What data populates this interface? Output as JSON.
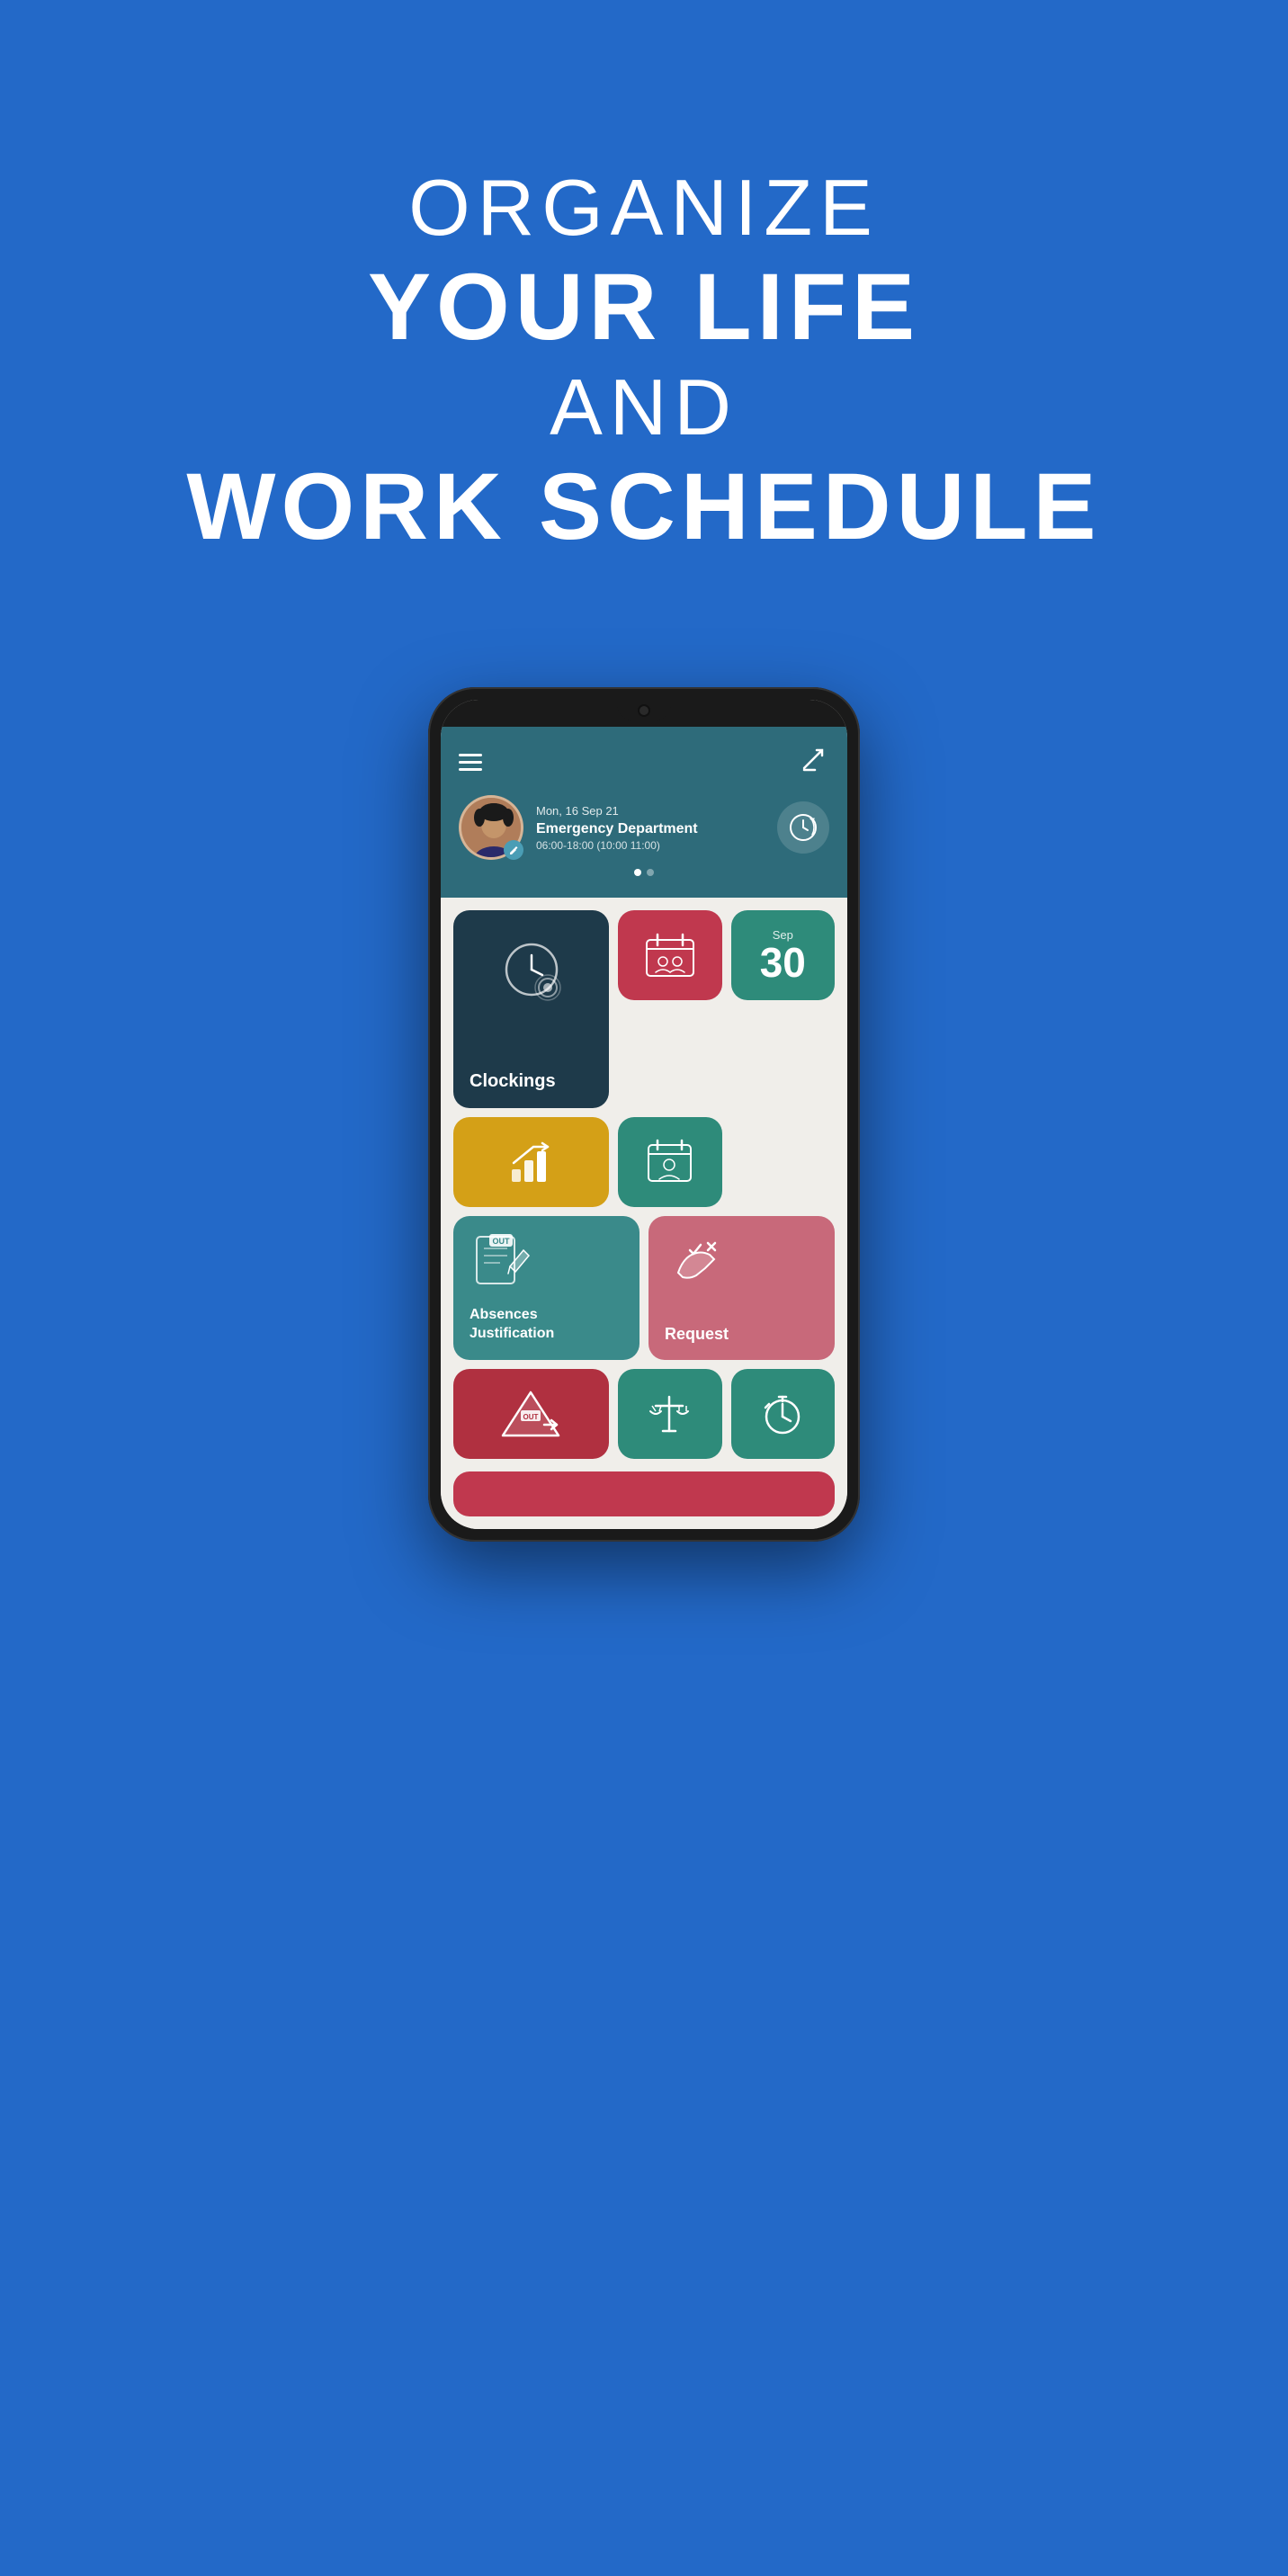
{
  "hero": {
    "line1": "ORGANIZE",
    "line2": "YOUR LIFE",
    "line3": "AND",
    "line4": "WORK SCHEDULE"
  },
  "phone": {
    "header": {
      "date": "Mon, 16 Sep 21",
      "department": "Emergency Department",
      "time": "06:00-18:00 (10:00 11:00)"
    },
    "tiles": {
      "clockings": "Clockings",
      "date_month": "Sep",
      "date_day": "30",
      "absences": "Absences\nJustification",
      "request": "Request"
    }
  }
}
